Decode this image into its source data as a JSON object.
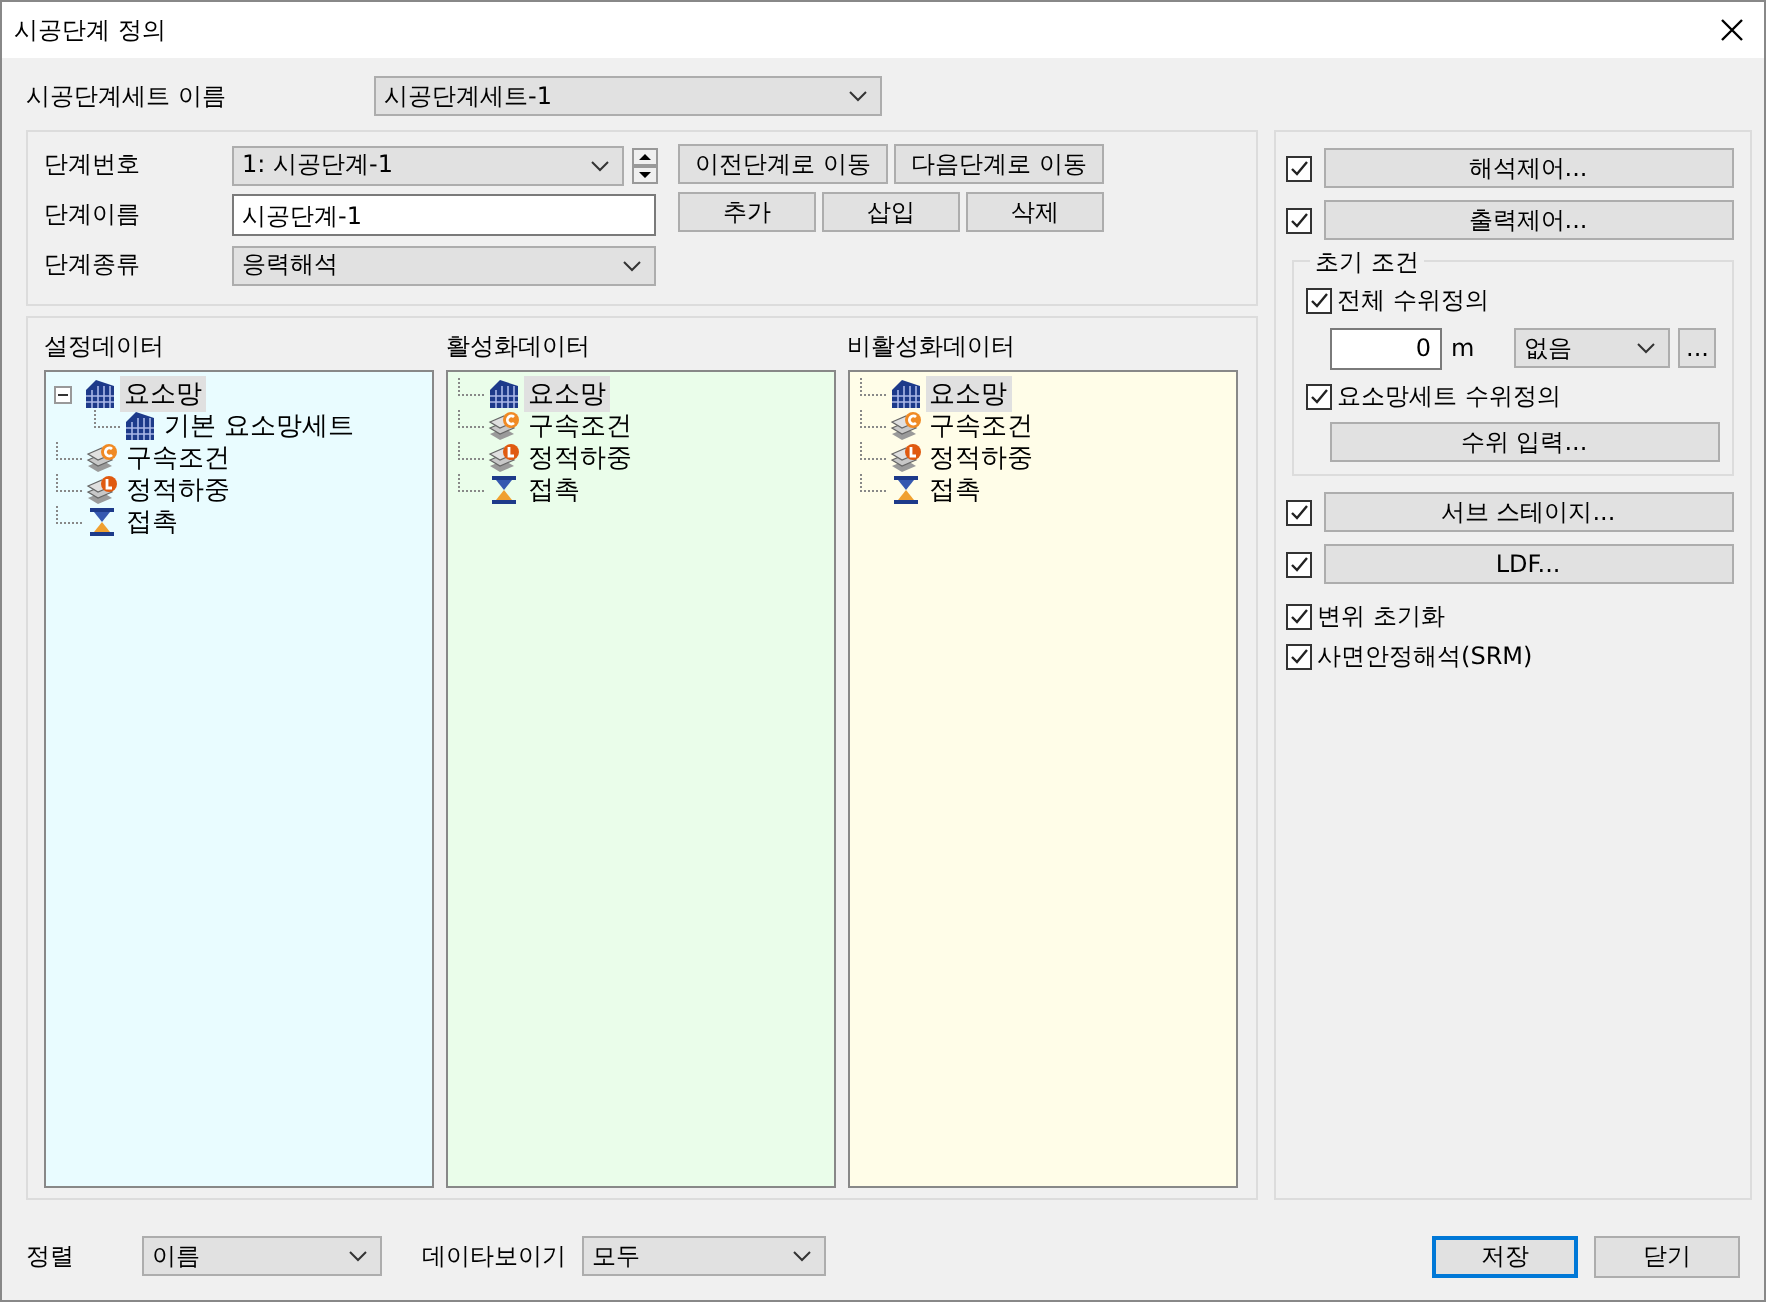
{
  "window": {
    "title": "시공단계 정의"
  },
  "stage_set": {
    "label": "시공단계세트 이름",
    "value": "시공단계세트-1"
  },
  "stage": {
    "fields": [
      {
        "kind": "combo",
        "label": "단계번호",
        "value": "1: 시공단계-1",
        "spinner": true
      },
      {
        "kind": "text",
        "label": "단계이름",
        "value": "시공단계-1"
      },
      {
        "kind": "combo",
        "label": "단계종류",
        "value": "응력해석",
        "spinner": false
      }
    ],
    "nav_buttons": [
      "이전단계로 이동",
      "다음단계로 이동"
    ],
    "edit_buttons": [
      "추가",
      "삽입",
      "삭제"
    ]
  },
  "trees": [
    {
      "title": "설정데이터",
      "color": "#e9fcff",
      "items": [
        {
          "kind": "mesh",
          "label": "요소망",
          "selected": true,
          "expanded": true,
          "children": [
            {
              "kind": "mesh",
              "label": "기본 요소망세트",
              "selected": false
            }
          ]
        },
        {
          "kind": "constraint",
          "label": "구속조건",
          "selected": false
        },
        {
          "kind": "load",
          "label": "정적하중",
          "selected": false
        },
        {
          "kind": "contact",
          "label": "접촉",
          "selected": false
        }
      ]
    },
    {
      "title": "활성화데이터",
      "color": "#eafdea",
      "items": [
        {
          "kind": "mesh",
          "label": "요소망",
          "selected": true
        },
        {
          "kind": "constraint",
          "label": "구속조건",
          "selected": false
        },
        {
          "kind": "load",
          "label": "정적하중",
          "selected": false
        },
        {
          "kind": "contact",
          "label": "접촉",
          "selected": false
        }
      ]
    },
    {
      "title": "비활성화데이터",
      "color": "#fffde8",
      "items": [
        {
          "kind": "mesh",
          "label": "요소망",
          "selected": true
        },
        {
          "kind": "constraint",
          "label": "구속조건",
          "selected": false
        },
        {
          "kind": "load",
          "label": "정적하중",
          "selected": false
        },
        {
          "kind": "contact",
          "label": "접촉",
          "selected": false
        }
      ]
    }
  ],
  "options": {
    "top": [
      {
        "kind": "check-button",
        "checked": true,
        "label": "해석제어..."
      },
      {
        "kind": "check-button",
        "checked": true,
        "label": "출력제어..."
      }
    ],
    "initial": {
      "title": "초기 조건",
      "global": {
        "checked": true,
        "label": "전체 수위정의"
      },
      "level_value": "0",
      "unit": "m",
      "level_mode": "없음",
      "more": "...",
      "set": {
        "checked": true,
        "label": "요소망세트 수위정의"
      },
      "input_button": "수위 입력..."
    },
    "bottom": [
      {
        "kind": "check-button",
        "checked": true,
        "label": "서브 스테이지..."
      },
      {
        "kind": "check-button",
        "checked": true,
        "label": "LDF..."
      },
      {
        "kind": "check",
        "checked": true,
        "label": "변위 초기화"
      },
      {
        "kind": "check",
        "checked": true,
        "label": "사면안정해석(SRM)"
      }
    ]
  },
  "footer": {
    "sort_label": "정렬",
    "sort_value": "이름",
    "view_label": "데이타보이기",
    "view_value": "모두",
    "buttons": [
      {
        "label": "저장",
        "selected": true
      },
      {
        "label": "닫기",
        "selected": false
      }
    ]
  }
}
